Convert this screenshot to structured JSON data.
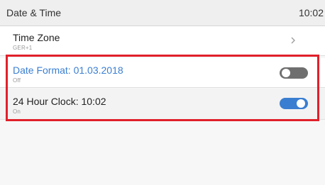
{
  "header": {
    "title": "Date & Time",
    "time": "10:02"
  },
  "settings": {
    "time_zone": {
      "label": "Time Zone",
      "value": "GER+1",
      "icon": "chevron-right-icon"
    },
    "date_format": {
      "label": "Date Format: 01.03.2018",
      "status": "Off",
      "toggle_on": false
    },
    "clock_24h": {
      "label": "24 Hour Clock: 10:02",
      "status": "On",
      "toggle_on": true
    }
  },
  "colors": {
    "accent": "#3a7ed1",
    "toggle_off": "#6f6f6f",
    "highlight": "#e0202a"
  }
}
